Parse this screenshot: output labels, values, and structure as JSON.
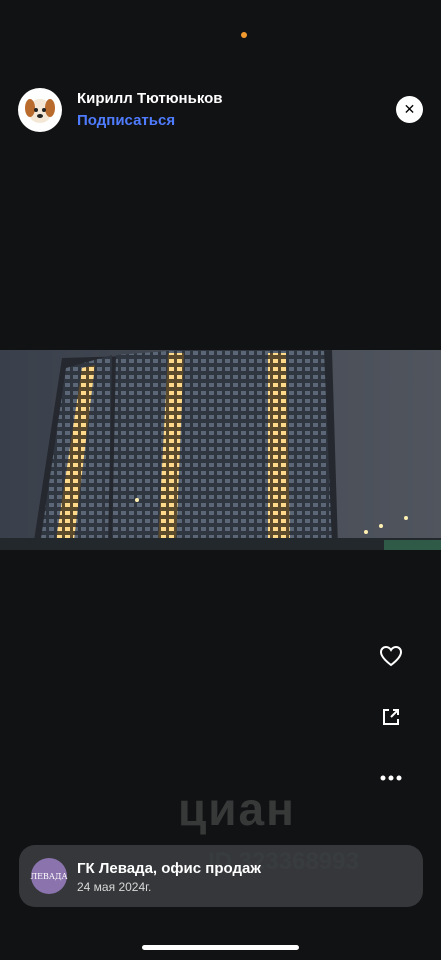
{
  "author": {
    "name": "Кирилл Тютюньков",
    "subscribe_label": "Подписаться",
    "avatar": "dog-emoji-avatar"
  },
  "actions": {
    "like": "heart-icon",
    "share": "share-icon",
    "more": "more-icon",
    "close": "close-icon"
  },
  "photo": {
    "subject": "residential-tower-at-dusk"
  },
  "watermark": {
    "brand": "циан",
    "id": "ID 323368993"
  },
  "agency": {
    "logo_text": "ЛЕВАДА",
    "name": "ГК Левада, офис продаж",
    "date": "24 мая 2024г."
  },
  "colors": {
    "accent": "#4f7cff",
    "background": "#111213",
    "status_dot": "#f39a2e",
    "agency_logo": "#8b73ad"
  }
}
